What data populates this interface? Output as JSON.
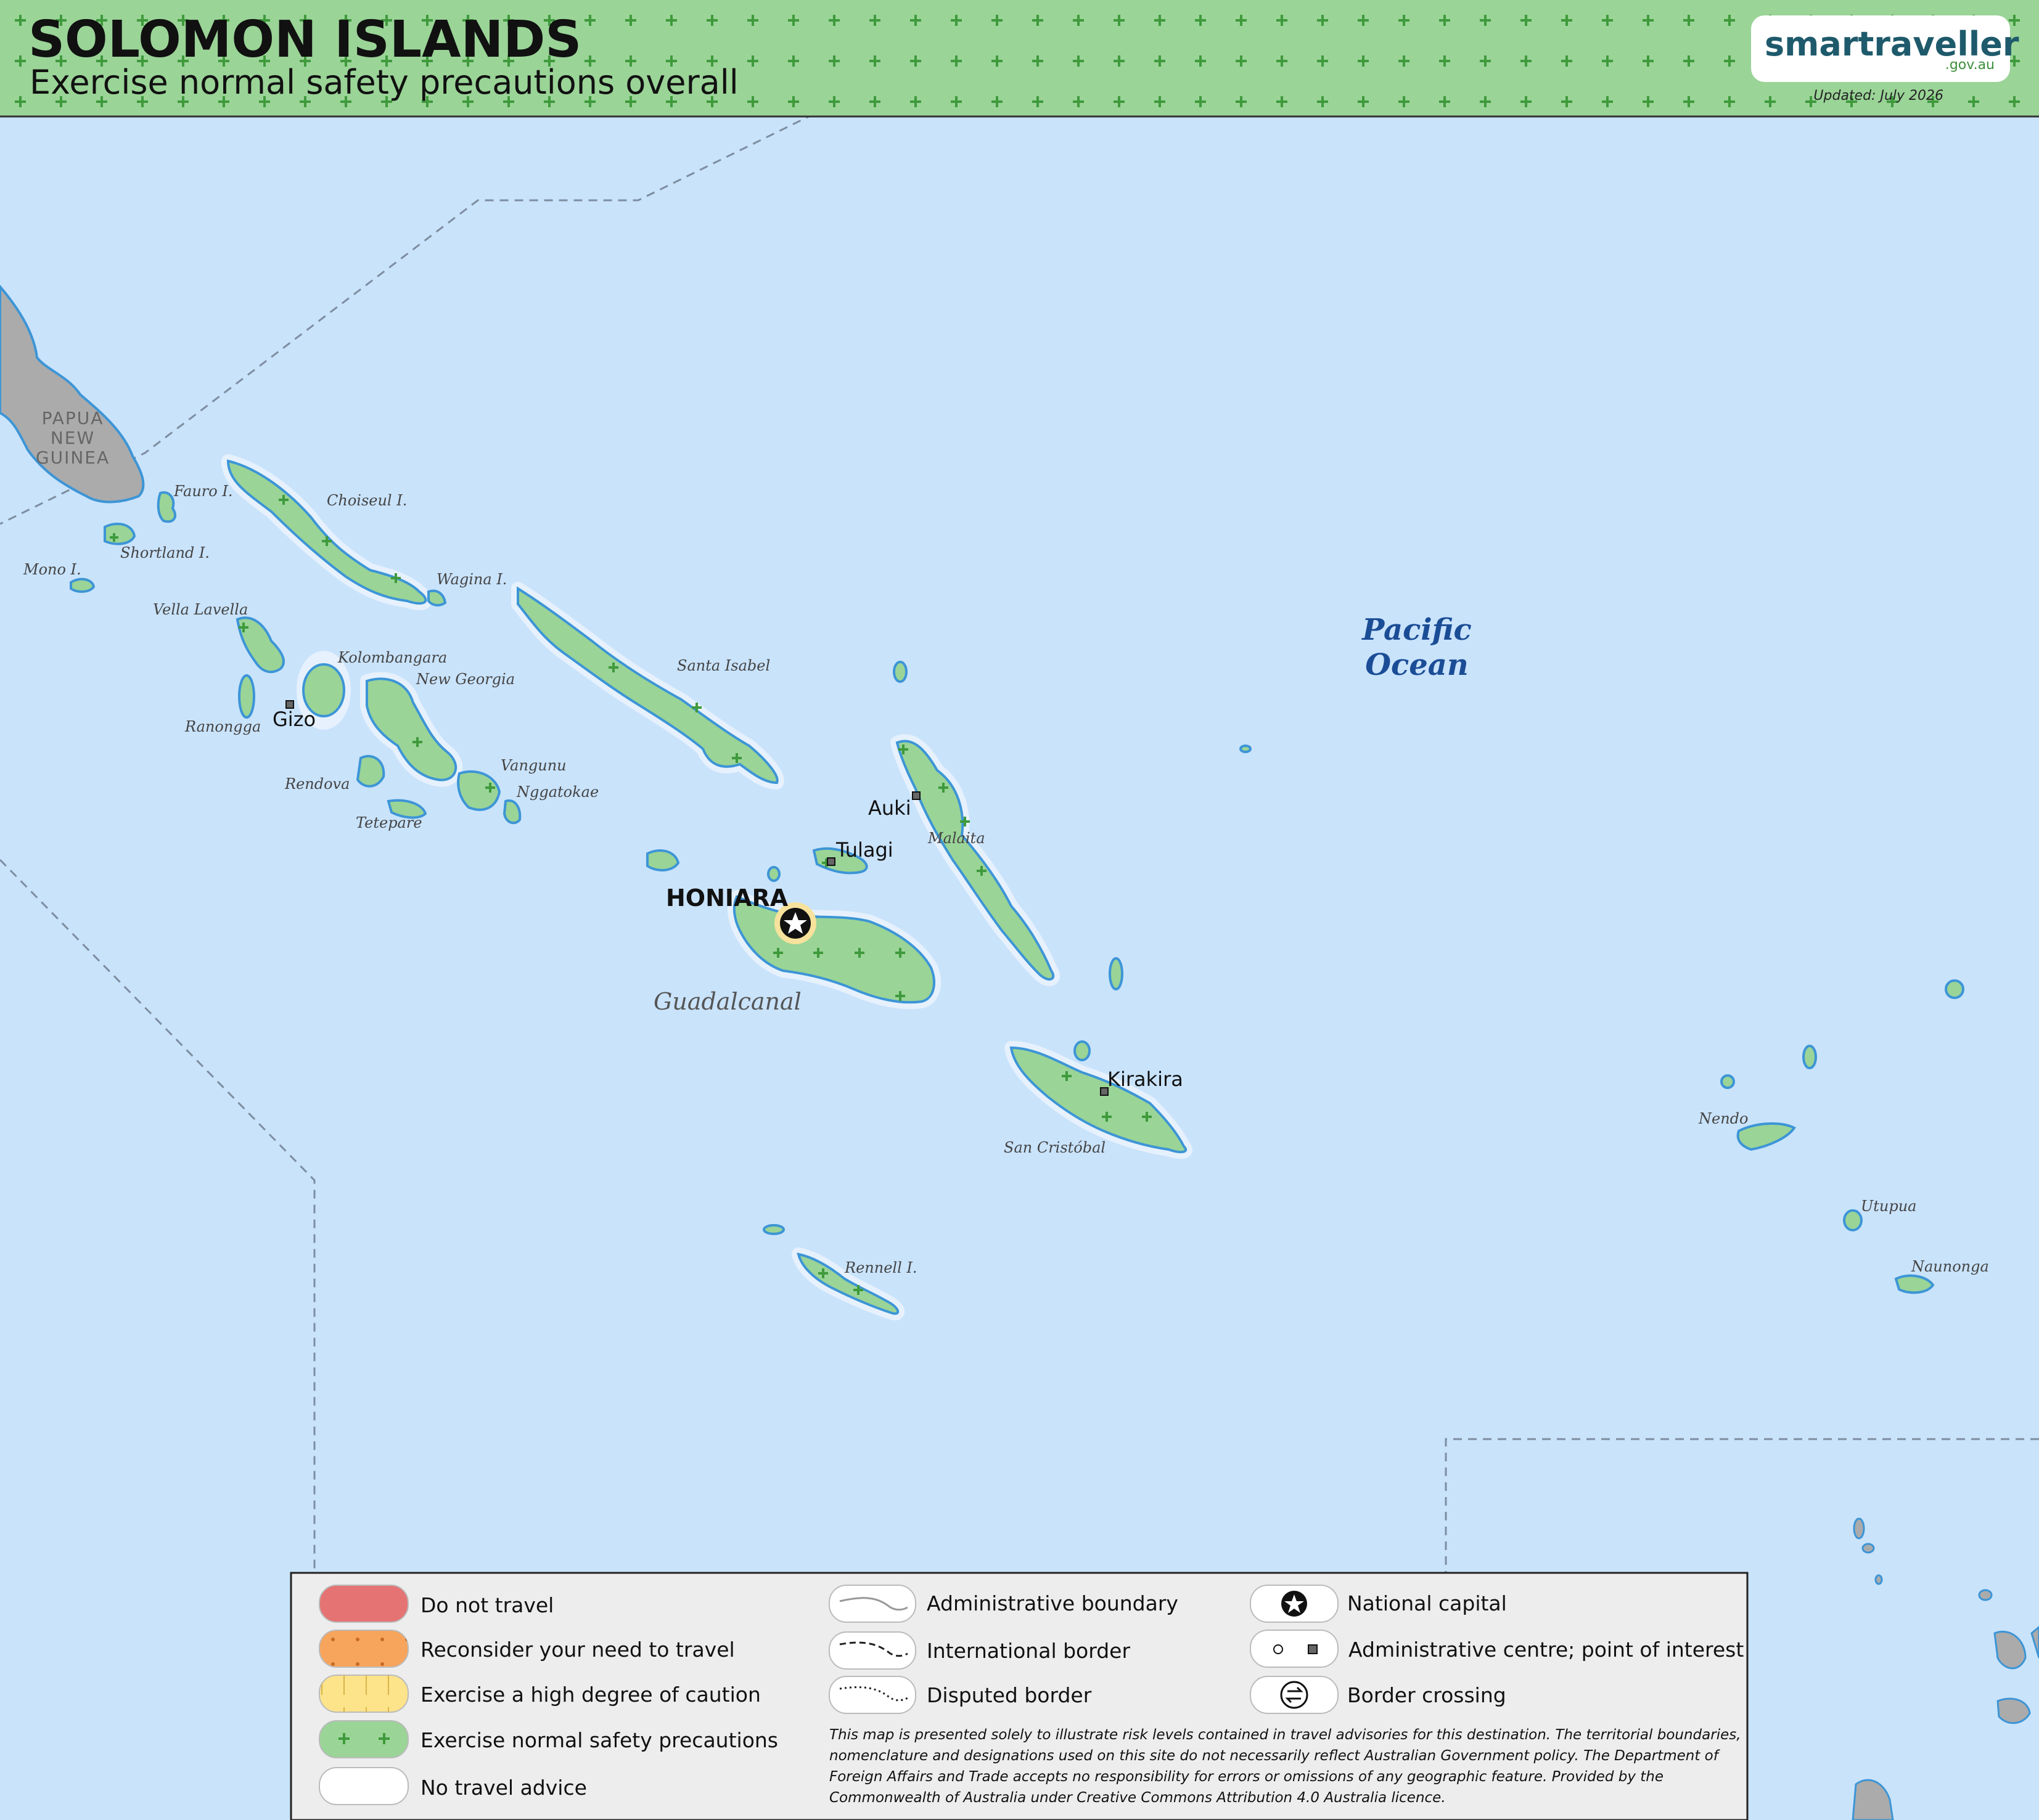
{
  "header": {
    "title": "SOLOMON ISLANDS",
    "subtitle": "Exercise normal safety precautions overall",
    "logo": "smartraveller",
    "logo_domain": ".gov.au",
    "updated": "Updated: July 2026",
    "band_color": "#9ad497"
  },
  "map": {
    "ocean_label_1": "Pacific",
    "ocean_label_2": "Ocean",
    "neighbour_1": "PAPUA",
    "neighbour_2": "NEW",
    "neighbour_3": "GUINEA",
    "islands": {
      "fauro": "Fauro I.",
      "choiseul": "Choiseul I.",
      "shortland": "Shortland I.",
      "mono": "Mono I.",
      "wagina": "Wagina I.",
      "vella_lavella": "Vella Lavella",
      "kolombangara": "Kolombangara",
      "new_georgia": "New Georgia",
      "ranongga": "Ranongga",
      "santa_isabel": "Santa Isabel",
      "vangunu": "Vangunu",
      "nggatokae": "Nggatokae",
      "rendova": "Rendova",
      "tetepare": "Tetepare",
      "malaita": "Malaita",
      "guadalcanal": "Guadalcanal",
      "san_cristobal": "San Cristóbal",
      "rennell": "Rennell I.",
      "nendo": "Nendo",
      "utupua": "Utupua",
      "naunonga": "Naunonga"
    },
    "towns": {
      "gizo": "Gizo",
      "auki": "Auki",
      "tulagi": "Tulagi",
      "kirakira": "Kirakira"
    },
    "capital": "HONIARA"
  },
  "legend": {
    "risk": [
      {
        "label": "Do not travel",
        "color": "#e57373"
      },
      {
        "label": "Reconsider your need to travel",
        "color": "#f7a55d"
      },
      {
        "label": "Exercise a high degree of caution",
        "color": "#fde38a"
      },
      {
        "label": "Exercise normal safety precautions",
        "color": "#9ad497"
      },
      {
        "label": "No travel advice",
        "color": "#ffffff"
      }
    ],
    "lines": [
      {
        "label": "Administrative boundary"
      },
      {
        "label": "International border"
      },
      {
        "label": "Disputed border"
      }
    ],
    "symbols": [
      {
        "label": "National capital",
        "icon": "star-icon"
      },
      {
        "label": "Administrative centre; point of interest",
        "icon": "circle-square-icon"
      },
      {
        "label": "Border crossing",
        "icon": "arrows-icon"
      }
    ],
    "disclaimer_1": "This map is presented solely to illustrate risk levels contained in travel advisories for this destination. The territorial boundaries,",
    "disclaimer_2": "nomenclature and designations used on this site do not necessarily reflect Australian Government policy. The Department of",
    "disclaimer_3": "Foreign Affairs and Trade accepts no responsibility for errors or omissions of any geographic feature. Provided by the",
    "disclaimer_4": "Commonwealth of Australia under Creative Commons Attribution 4.0 Australia licence."
  }
}
